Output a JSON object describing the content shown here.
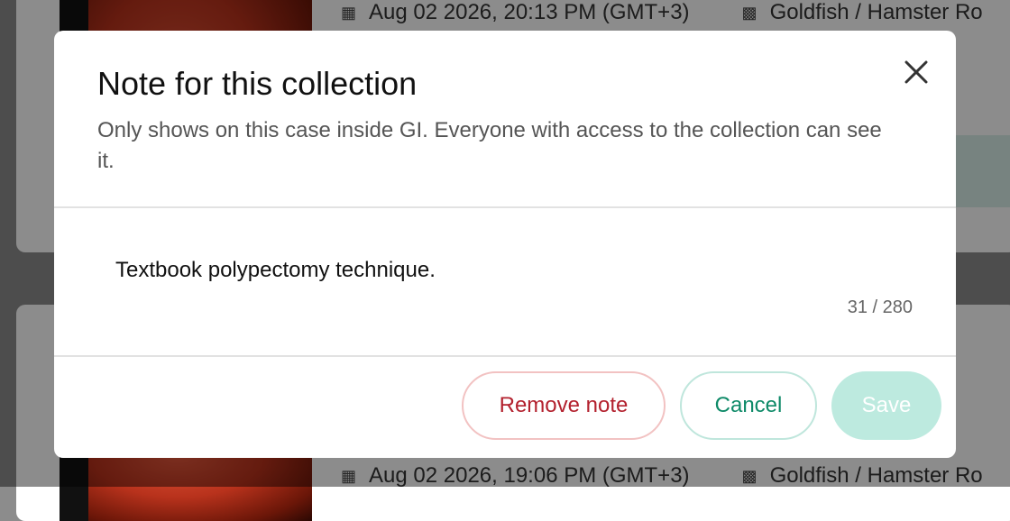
{
  "background": {
    "items": [
      {
        "date": "Aug 02 2026, 20:13 PM (GMT+3)",
        "location": "Goldfish / Hamster Ro"
      },
      {
        "date": "Aug 02 2026, 19:06 PM (GMT+3)",
        "location": "Goldfish / Hamster Ro"
      }
    ]
  },
  "modal": {
    "title": "Note for this collection",
    "subtitle": "Only shows on this case inside GI. Everyone with access to the collection can see it.",
    "note_value": "Textbook polypectomy technique.",
    "counter": "31 / 280",
    "buttons": {
      "remove": "Remove note",
      "cancel": "Cancel",
      "save": "Save"
    }
  },
  "colors": {
    "remove": "#b3212e",
    "cancel": "#0e8a68",
    "save_disabled_bg": "#bdeadf"
  }
}
